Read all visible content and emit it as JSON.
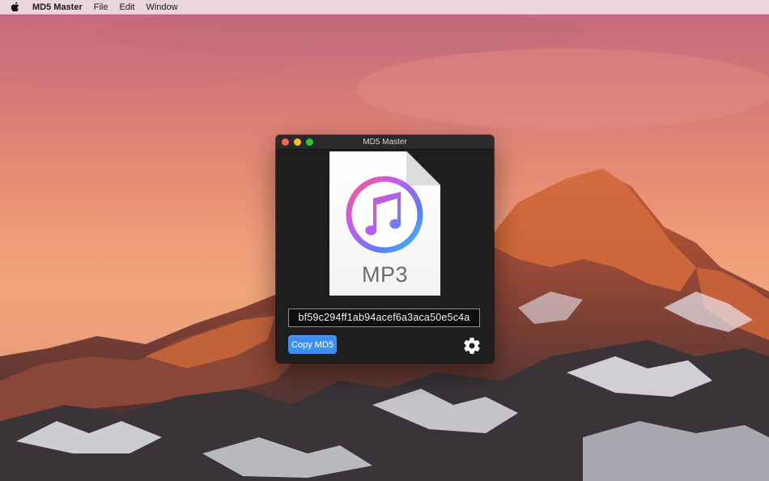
{
  "menubar": {
    "apple_icon": "apple-logo-icon",
    "app_name": "MD5 Master",
    "items": [
      "File",
      "Edit",
      "Window"
    ]
  },
  "window": {
    "title": "MD5 Master",
    "file": {
      "icon": "itunes-music-note-icon",
      "extension": "MP3"
    },
    "md5_hash": "bf59c294ff1ab94acef6a3aca50e5c4a",
    "copy_button_label": "Copy MD5",
    "settings_icon": "gear-icon",
    "colors": {
      "copy_button": "#3d8ff3",
      "window_background": "#1e1e1e",
      "close": "#fc5f57",
      "minimize": "#fdbc2e",
      "zoom": "#2ac840"
    }
  }
}
